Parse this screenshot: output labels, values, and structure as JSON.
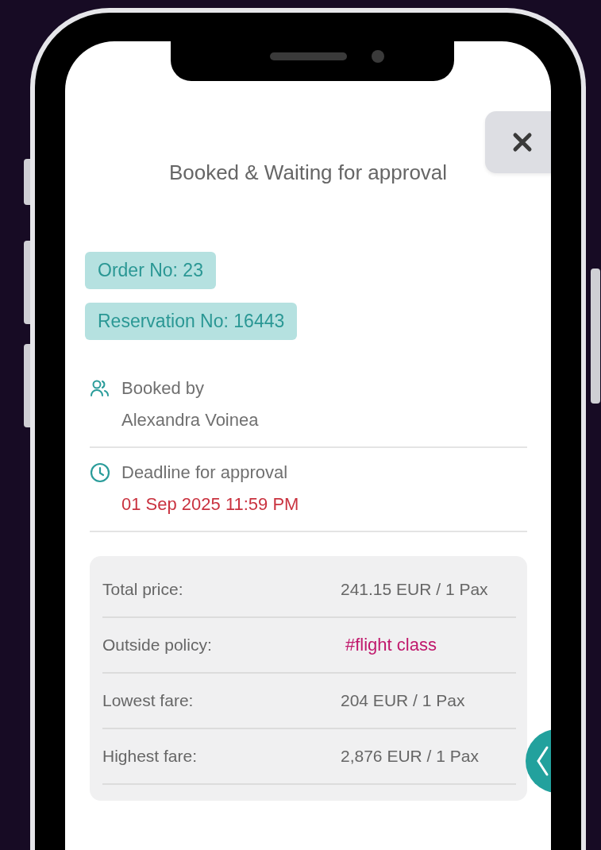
{
  "title": "Booked & Waiting for approval",
  "badges": [
    "Order No: 23",
    "Reservation No: 16443"
  ],
  "info": [
    {
      "kind": "people",
      "label": "Booked by",
      "value": "Alexandra Voinea",
      "alert": false
    },
    {
      "kind": "clock",
      "label": "Deadline for approval",
      "value": "01 Sep 2025 11:59 PM",
      "alert": true
    }
  ],
  "price_rows": [
    {
      "label": "Total price:",
      "value": "241.15 EUR / 1 Pax",
      "kind": "text"
    },
    {
      "label": "Outside policy:",
      "value": "#flight class",
      "kind": "tag"
    },
    {
      "label": "Lowest fare:",
      "value": "204 EUR / 1 Pax",
      "kind": "text"
    },
    {
      "label": "Highest fare:",
      "value": "2,876 EUR / 1 Pax",
      "kind": "text"
    }
  ]
}
